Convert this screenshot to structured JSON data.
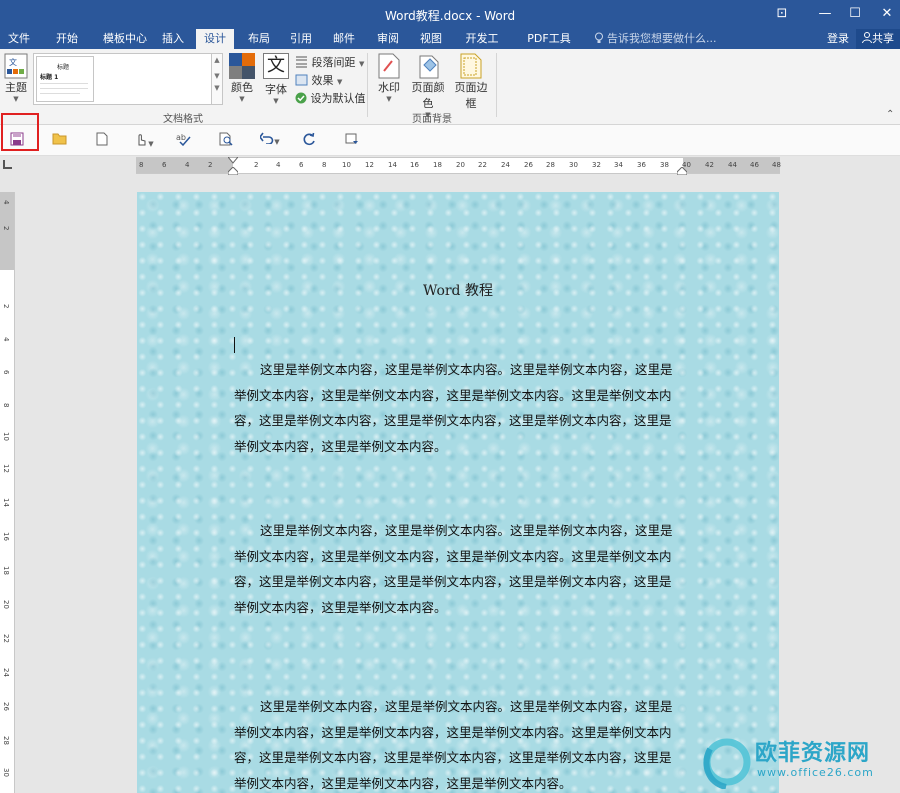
{
  "window": {
    "title": "Word教程.docx - Word",
    "controls": {
      "restore": "⊡",
      "minimize": "—",
      "maximize": "☐",
      "close": "✕"
    }
  },
  "tabs": [
    "文件",
    "开始",
    "模板中心",
    "插入",
    "设计",
    "布局",
    "引用",
    "邮件",
    "审阅",
    "视图",
    "开发工具",
    "PDF工具集"
  ],
  "active_tab": "设计",
  "tell_me_placeholder": "告诉我您想要做什么...",
  "account": {
    "signin": "登录",
    "share": "共享"
  },
  "ribbon": {
    "theme_label": "主题",
    "gallery_thumb": {
      "heading": "标题",
      "style": "标题 1"
    },
    "colors_label": "颜色",
    "fonts_label": "字体",
    "fonts_glyph": "文",
    "paragraph_spacing": "段落间距",
    "effects": "效果",
    "set_default": "设为默认值",
    "group_doc_format": "文档格式",
    "watermark_label": "水印",
    "page_color_label": "页面颜色",
    "page_borders_label": "页面边框",
    "group_page_bg": "页面背景",
    "collapse_icon": "⌃"
  },
  "ruler": {
    "horizontal": [
      "8",
      "6",
      "4",
      "2",
      "2",
      "4",
      "6",
      "8",
      "10",
      "12",
      "14",
      "16",
      "18",
      "20",
      "22",
      "24",
      "26",
      "28",
      "30",
      "32",
      "34",
      "36",
      "38",
      "40",
      "42",
      "44",
      "46",
      "48"
    ],
    "vertical": [
      "4",
      "2",
      "2",
      "4",
      "6",
      "8",
      "10",
      "12",
      "14",
      "16",
      "18",
      "20",
      "22",
      "24",
      "26",
      "28",
      "30"
    ]
  },
  "document": {
    "title": "Word 教程",
    "paragraphs": [
      "这里是举例文本内容，这里是举例文本内容。这里是举例文本内容，这里是举例文本内容，这里是举例文本内容，这里是举例文本内容。这里是举例文本内容，这里是举例文本内容，这里是举例文本内容，这里是举例文本内容，这里是举例文本内容，这里是举例文本内容。",
      "这里是举例文本内容，这里是举例文本内容。这里是举例文本内容，这里是举例文本内容，这里是举例文本内容，这里是举例文本内容。这里是举例文本内容，这里是举例文本内容，这里是举例文本内容，这里是举例文本内容，这里是举例文本内容，这里是举例文本内容。",
      "这里是举例文本内容，这里是举例文本内容。这里是举例文本内容，这里是举例文本内容，这里是举例文本内容，这里是举例文本内容。这里是举例文本内容，这里是举例文本内容，这里是举例文本内容，这里是举例文本内容，这里是举例文本内容，这里是举例文本内容，这里是举例文本内容。"
    ]
  },
  "watermark": {
    "text": "欧菲资源网",
    "url": "www.office26.com"
  },
  "colors": {
    "title_bar": "#2b579a",
    "highlight": "#e02020",
    "page_bg": "#a9dbe4",
    "watermark": "#2da6c8"
  }
}
